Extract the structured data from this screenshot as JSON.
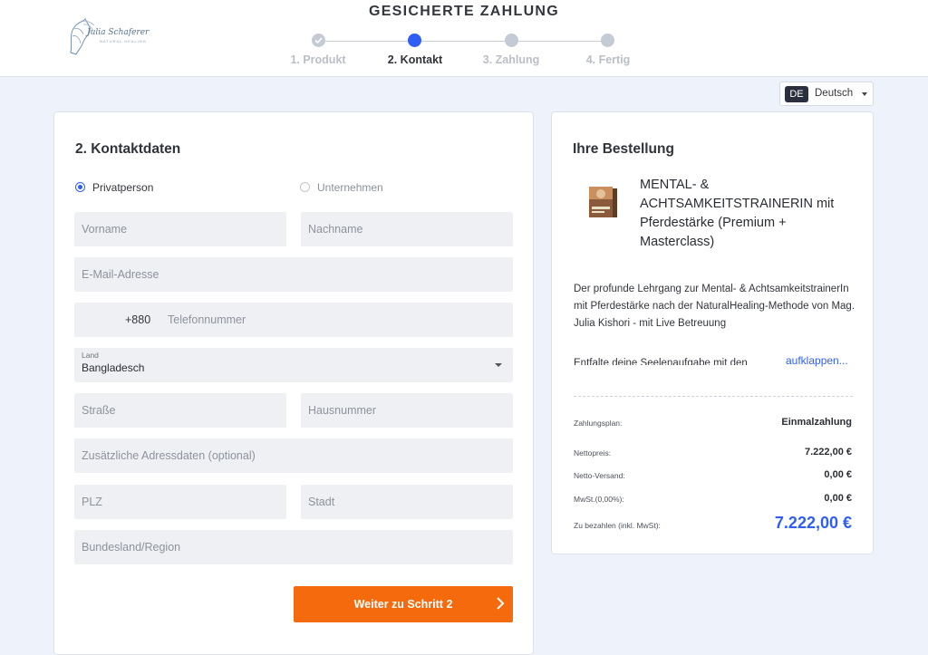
{
  "header": {
    "title": "GESICHERTE ZAHLUNG",
    "logo": {
      "name": "Julia Schaferer",
      "tagline": "NATURAL HEALING"
    },
    "steps": [
      {
        "label": "1. Produkt",
        "state": "done"
      },
      {
        "label": "2. Kontakt",
        "state": "active"
      },
      {
        "label": "3. Zahlung",
        "state": "pending"
      },
      {
        "label": "4. Fertig",
        "state": "pending"
      }
    ]
  },
  "language": {
    "code": "DE",
    "name": "Deutsch"
  },
  "form": {
    "title": "2. Kontaktdaten",
    "customer_type": {
      "options": [
        "Privatperson",
        "Unternehmen"
      ],
      "selected": "Privatperson"
    },
    "fields": {
      "first_name": {
        "placeholder": "Vorname"
      },
      "last_name": {
        "placeholder": "Nachname"
      },
      "email": {
        "placeholder": "E-Mail-Adresse"
      },
      "phone": {
        "prefix": "+880",
        "placeholder": "Telefonnummer"
      },
      "country": {
        "label": "Land",
        "value": "Bangladesch"
      },
      "street": {
        "placeholder": "Straße"
      },
      "house_number": {
        "placeholder": "Hausnummer"
      },
      "address_extra": {
        "placeholder": "Zusätzliche Adressdaten (optional)"
      },
      "zip": {
        "placeholder": "PLZ"
      },
      "city": {
        "placeholder": "Stadt"
      },
      "state": {
        "placeholder": "Bundesland/Region"
      }
    },
    "submit_label": "Weiter zu Schritt 2"
  },
  "order": {
    "title": "Ihre Bestellung",
    "product_name": "MENTAL- & ACHTSAMKEITSTRAINERIN mit Pferdestärke (Premium + Masterclass)",
    "description": "Der profunde Lehrgang zur Mental- & AchtsamkeitstrainerIn mit Pferdestärke nach der NaturalHealing-Methode von Mag. Julia Kishori - mit Live Betreuung",
    "description_more": "Entfalte deine Seelenaufgabe mit den",
    "expand_label": "aufklappen...",
    "rows": [
      {
        "label": "Zahlungsplan:",
        "value": "Einmalzahlung"
      },
      {
        "label": "Nettopreis:",
        "value": "7.222,00 €"
      },
      {
        "label": "Netto-Versand:",
        "value": "0,00 €"
      },
      {
        "label": "MwSt.(0,00%):",
        "value": "0,00 €"
      },
      {
        "label": "Zu bezahlen (inkl. MwSt):",
        "value": "7.222,00 €"
      }
    ],
    "colors": {
      "accent": "#2f5ef5",
      "cta": "#f46a0d"
    }
  }
}
